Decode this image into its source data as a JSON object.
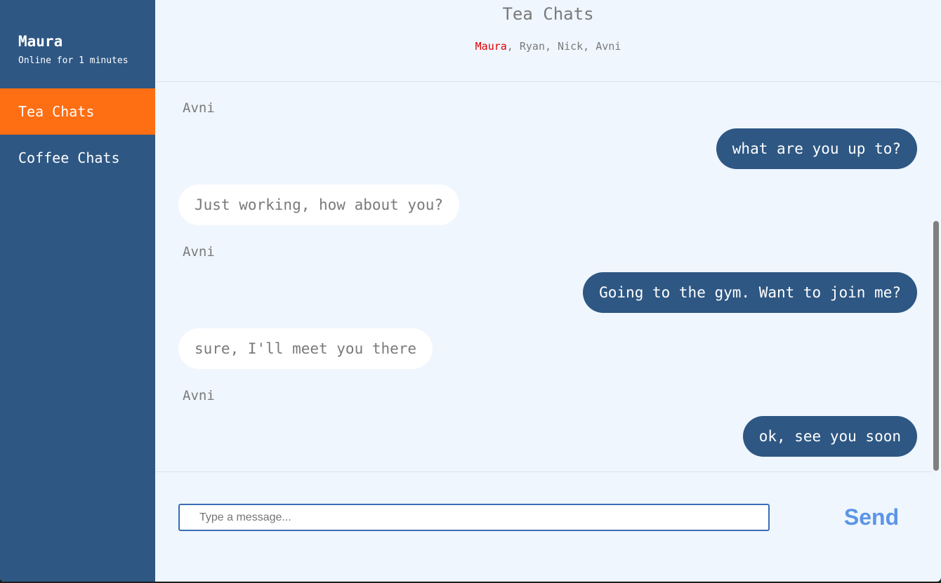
{
  "user": {
    "name": "Maura",
    "status": "Online for 1 minutes"
  },
  "sidebar": {
    "items": [
      {
        "label": "Tea Chats",
        "active": true
      },
      {
        "label": "Coffee Chats",
        "active": false
      }
    ]
  },
  "header": {
    "title": "Tea Chats",
    "members_self": "Maura",
    "members_rest": ", Ryan, Nick, Avni"
  },
  "messages": [
    {
      "sender": "Avni"
    },
    {
      "text": "what are you up to?",
      "direction": "outgoing"
    },
    {
      "text": "Just working, how about you?",
      "direction": "incoming"
    },
    {
      "sender": "Avni"
    },
    {
      "text": "Going to the gym. Want to join me?",
      "direction": "outgoing"
    },
    {
      "text": "sure, I'll meet you there",
      "direction": "incoming"
    },
    {
      "sender": "Avni"
    },
    {
      "text": "ok, see you soon",
      "direction": "outgoing"
    }
  ],
  "composer": {
    "placeholder": "Type a message...",
    "value": "",
    "send_label": "Send"
  },
  "colors": {
    "sidebar_bg": "#2e5783",
    "active_item": "#fe6e13",
    "main_bg": "#eff6fe",
    "outgoing_bubble": "#2e5783",
    "incoming_bubble": "#ffffff",
    "self_member": "#e00000",
    "send_button": "#5b95e6"
  }
}
